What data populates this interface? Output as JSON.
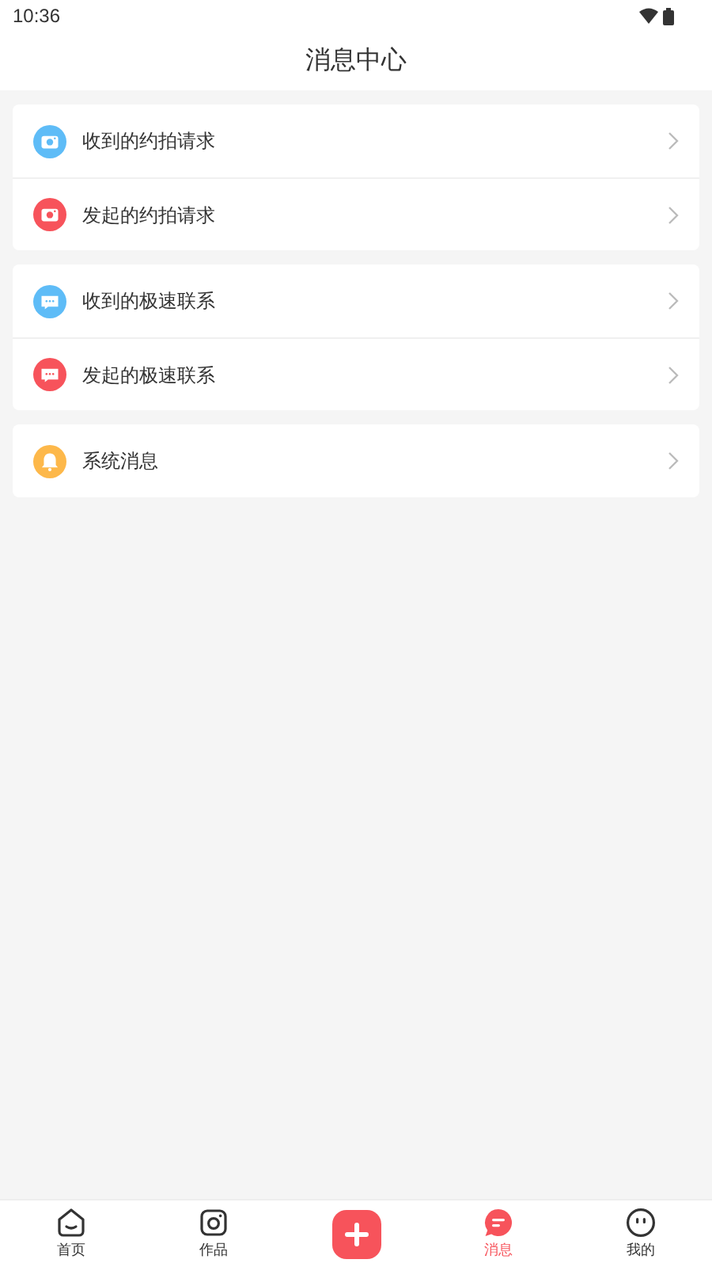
{
  "status_bar": {
    "time": "10:36"
  },
  "header": {
    "title": "消息中心"
  },
  "groups": [
    {
      "items": [
        {
          "label": "收到的约拍请求",
          "kind": "camera",
          "color": "#5ebcf7"
        },
        {
          "label": "发起的约拍请求",
          "kind": "camera",
          "color": "#f7535b"
        }
      ]
    },
    {
      "items": [
        {
          "label": "收到的极速联系",
          "kind": "chat",
          "color": "#5ebcf7"
        },
        {
          "label": "发起的极速联系",
          "kind": "chat",
          "color": "#f7535b"
        }
      ]
    },
    {
      "items": [
        {
          "label": "系统消息",
          "kind": "bell",
          "color": "#fdb84a"
        }
      ]
    }
  ],
  "tab_bar": [
    {
      "kind": "home",
      "label": "首页",
      "selected": false
    },
    {
      "kind": "works",
      "label": "作品",
      "selected": false
    },
    {
      "kind": "add",
      "selected": false
    },
    {
      "kind": "messages",
      "label": "消息",
      "selected": true
    },
    {
      "kind": "me",
      "label": "我的",
      "selected": false
    }
  ]
}
